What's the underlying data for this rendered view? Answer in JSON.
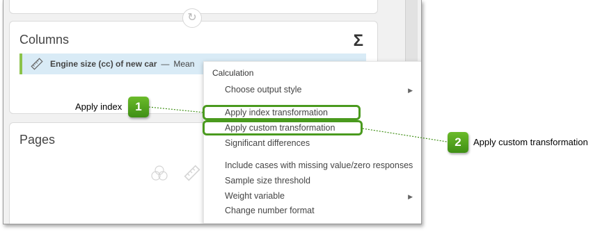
{
  "columns_panel": {
    "title": "Columns",
    "sigma": "Σ",
    "field": {
      "name": "Engine size (cc) of new car",
      "separator": "—",
      "statistic": "Mean"
    }
  },
  "pages_panel": {
    "title": "Pages"
  },
  "swap_icon": "↻",
  "context_menu": {
    "header": "Calculation",
    "items": [
      {
        "label": "Choose output style",
        "submenu": true
      },
      {
        "label": "Apply index transformation",
        "submenu": false
      },
      {
        "label": "Apply custom transformation",
        "submenu": false
      },
      {
        "label": "Significant differences",
        "submenu": false
      },
      {
        "label": "Include cases with missing value/zero responses",
        "submenu": false
      },
      {
        "label": "Sample size threshold",
        "submenu": false
      },
      {
        "label": "Weight variable",
        "submenu": true
      },
      {
        "label": "Change number format",
        "submenu": false
      }
    ]
  },
  "callouts": [
    {
      "number": "1",
      "label": "Apply index"
    },
    {
      "number": "2",
      "label": "Apply custom transformation"
    }
  ],
  "colors": {
    "accent": "#4a9a1e",
    "chip": "#d9ebf6",
    "chip_border": "#8bc34a"
  }
}
